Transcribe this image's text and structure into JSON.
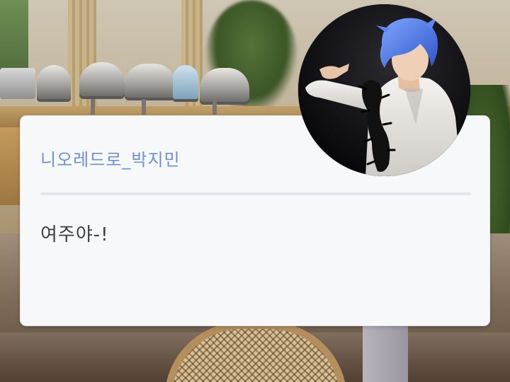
{
  "dialog": {
    "speaker_name": "니오레드로_박지민",
    "message": "여주야-!"
  },
  "colors": {
    "name_color": "#6f8fd3",
    "card_background": "#f7f8fa",
    "divider": "#e4e6eb",
    "message_text": "#3e3e3e"
  },
  "avatar": {
    "subject": "performer-with-blue-hair-white-suit",
    "icon": "avatar-photo"
  }
}
